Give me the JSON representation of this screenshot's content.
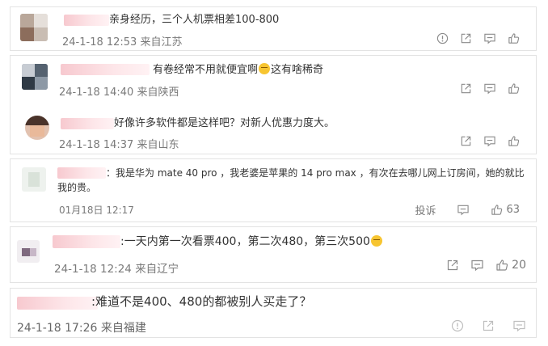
{
  "comments": [
    {
      "text": "亲身经历，三个人机票相差100-800",
      "time": "24-1-18 12:53",
      "location": "来自江苏",
      "actions": [
        "report-icon",
        "share-icon",
        "comment-icon",
        "like-icon"
      ]
    },
    {
      "text_before": "有卷经常不用就便宜啊",
      "text_after": "这有啥稀奇",
      "time": "24-1-18 14:40",
      "location": "来自陕西",
      "actions": [
        "share-icon",
        "comment-icon",
        "like-icon"
      ]
    },
    {
      "text": "好像许多软件都是这样吧？对新人优惠力度大。",
      "time": "24-1-18 14:37",
      "location": "来自山东",
      "actions": [
        "share-icon",
        "comment-icon",
        "like-icon"
      ]
    },
    {
      "text_line1": "：我是华为 mate 40 pro ，我老婆是苹果的 14 pro max ，有次在去哪儿网上订房间，她的就比",
      "text_line2": "我的贵。",
      "time": "01月18日 12:17",
      "report_label": "投诉",
      "like_count": "63"
    },
    {
      "text": ":一天内第一次看票400，第二次480，第三次500",
      "time": "24-1-18 12:24",
      "location": "来自辽宁",
      "like_count": "20"
    },
    {
      "text": ":难道不是400、480的都被别人买走了？",
      "time": "24-1-18 17:26",
      "location": "来自福建"
    }
  ]
}
